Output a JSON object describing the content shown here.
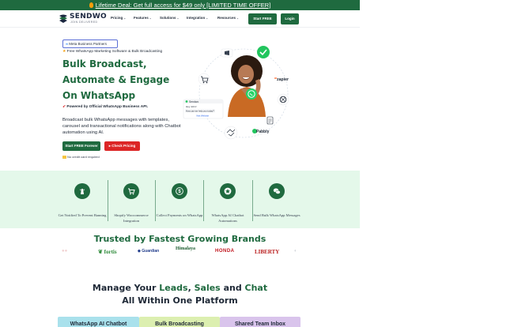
{
  "banner": {
    "text": "Lifetime Deal: Get full access for $49 only [LIMITED TIME OFFER]"
  },
  "nav": {
    "logo_text": "SENDWO",
    "logo_sub": "JOIN DELIVERED",
    "items": [
      {
        "label": "Pricing"
      },
      {
        "label": "Features"
      },
      {
        "label": "Solutions"
      },
      {
        "label": "Integration"
      },
      {
        "label": "Resources"
      }
    ],
    "start_free": "Start FREE",
    "login": "Login"
  },
  "hero": {
    "meta_badge": "Meta Business Partners",
    "tagline": "Free WhatsApp Marketing Software & Bulk Broadcasting",
    "headline": [
      "Bulk Broadcast,",
      "Automate & Engage",
      "On WhatsApp"
    ],
    "powered": "Powered by Official WhatsApp Business API.",
    "description": "Broadcast bulk WhatsApp messages with templates, carousel and transactional notifications along with Chatbot automation using AI.",
    "cta_primary": "Start FREE Forever",
    "cta_secondary": "Check Pricing",
    "no_card": "No credit card required"
  },
  "illustration": {
    "chat_title": "Sendwo",
    "chat_greeting": "Hey John!",
    "chat_question": "How can we help you today?",
    "chat_link": "Visit Website",
    "zapier": "zapier",
    "pabbly": "Pabbly",
    "colors": {
      "whatsapp": "#25d366",
      "accent": "#1f6a3f"
    }
  },
  "features": [
    {
      "label": "Get Notified To Prevent Banning",
      "icon": "lighthouse-icon"
    },
    {
      "label": "Shopify Woocommerce Integration",
      "icon": "cart-icon"
    },
    {
      "label": "Collect Payments on WhatsApp",
      "icon": "dollar-icon"
    },
    {
      "label": "WhatsApp AI Chatbot Automations",
      "icon": "star-icon"
    },
    {
      "label": "Send Bulk WhatsApp Messages",
      "icon": "chat-bubbles-icon"
    }
  ],
  "trusted": {
    "title": "Trusted by Fastest Growing Brands",
    "brands": [
      {
        "name": "fortis",
        "color": "#2e8b3a"
      },
      {
        "name": "Guardian",
        "color": "#1e3a8a"
      },
      {
        "name": "Himalaya",
        "color": "#1a5b2e"
      },
      {
        "name": "HONDA",
        "color": "#c0141c"
      },
      {
        "name": "LIBERTY",
        "color": "#b91c1c"
      }
    ]
  },
  "manage": {
    "line1_a": "Manage Your ",
    "line1_leads": "Leads",
    "line1_b": ", ",
    "line1_sales": "Sales",
    "line1_c": " and ",
    "line1_chat": "Chat",
    "line2": "All Within One Platform"
  },
  "tabs": [
    {
      "label": "WhatsApp AI Chatbot",
      "color": "#a9e1ec"
    },
    {
      "label": "Bulk Broadcasting",
      "color": "#dcefb0"
    },
    {
      "label": "Shared Team Inbox",
      "color": "#d9c4ec"
    }
  ]
}
